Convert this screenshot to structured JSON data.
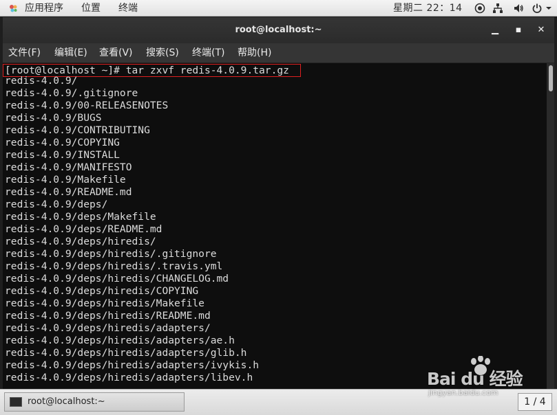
{
  "topbar": {
    "apps_label": "应用程序",
    "places_label": "位置",
    "terminal_label": "终端",
    "clock": "星期二 22：14"
  },
  "window": {
    "title": "root@localhost:~",
    "minimize_label": "▁",
    "maximize_label": "▪",
    "close_label": "✕"
  },
  "menubar": {
    "items": [
      "文件(F)",
      "编辑(E)",
      "查看(V)",
      "搜索(S)",
      "终端(T)",
      "帮助(H)"
    ]
  },
  "terminal": {
    "lines": [
      "[root@localhost ~]# tar zxvf redis-4.0.9.tar.gz",
      "redis-4.0.9/",
      "redis-4.0.9/.gitignore",
      "redis-4.0.9/00-RELEASENOTES",
      "redis-4.0.9/BUGS",
      "redis-4.0.9/CONTRIBUTING",
      "redis-4.0.9/COPYING",
      "redis-4.0.9/INSTALL",
      "redis-4.0.9/MANIFESTO",
      "redis-4.0.9/Makefile",
      "redis-4.0.9/README.md",
      "redis-4.0.9/deps/",
      "redis-4.0.9/deps/Makefile",
      "redis-4.0.9/deps/README.md",
      "redis-4.0.9/deps/hiredis/",
      "redis-4.0.9/deps/hiredis/.gitignore",
      "redis-4.0.9/deps/hiredis/.travis.yml",
      "redis-4.0.9/deps/hiredis/CHANGELOG.md",
      "redis-4.0.9/deps/hiredis/COPYING",
      "redis-4.0.9/deps/hiredis/Makefile",
      "redis-4.0.9/deps/hiredis/README.md",
      "redis-4.0.9/deps/hiredis/adapters/",
      "redis-4.0.9/deps/hiredis/adapters/ae.h",
      "redis-4.0.9/deps/hiredis/adapters/glib.h",
      "redis-4.0.9/deps/hiredis/adapters/ivykis.h",
      "redis-4.0.9/deps/hiredis/adapters/libev.h"
    ],
    "highlight_color": "#e02020"
  },
  "taskbar": {
    "task_label": "root@localhost:~",
    "pager": "1 / 4"
  },
  "watermark": {
    "brand": "Bai du 经验",
    "url": "jingyan.baidu.com"
  }
}
